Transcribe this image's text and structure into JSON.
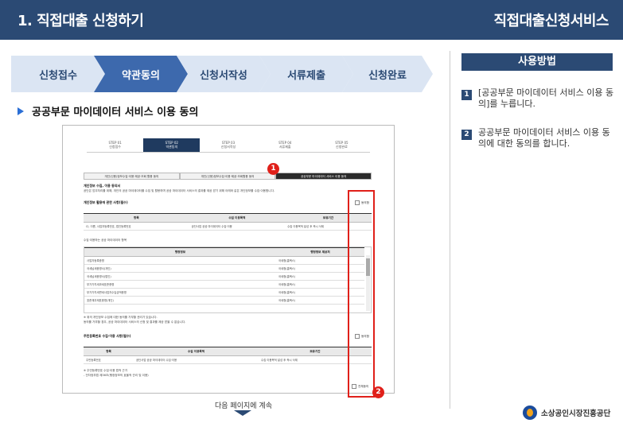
{
  "header": {
    "title": "1. 직접대출 신청하기",
    "service": "직접대출신청서비스"
  },
  "steps": [
    {
      "label": "신청접수",
      "active": false
    },
    {
      "label": "약관동의",
      "active": true
    },
    {
      "label": "신청서작성",
      "active": false
    },
    {
      "label": "서류제출",
      "active": false
    },
    {
      "label": "신청완료",
      "active": false
    }
  ],
  "section_title": "공공부문 마이데이터 서비스 이용 동의",
  "screenshot": {
    "mini_steps": [
      {
        "step": "STEP 01",
        "label": "신청접수"
      },
      {
        "step": "STEP 02",
        "label": "약관동의"
      },
      {
        "step": "STEP 03",
        "label": "신청서작성"
      },
      {
        "step": "STEP 04",
        "label": "서류제출"
      },
      {
        "step": "STEP 05",
        "label": "신청완료"
      }
    ],
    "tabs": [
      "개인(신용)정보수집·이용·제공·조회 활용 동의",
      "개인(신용)정보수집·이용·제공·조회활용 동의",
      "공공부문 마이데이터 서비스 이용 동의"
    ],
    "consent_title": "개인정보 수집, 이용 동의서",
    "consent_desc": "공단은 업무처리를 위해, 개인의 공공 마이데이터를 수집 및 활용하며 공공 마이데이터 서비스의 결과를 제공 받기 위해 아래와 같은 개인정보를 수집·이용합니다.",
    "section1": "개인정보 활용에 관한 사항(필수)",
    "agree_label": "동의함",
    "table_headers": [
      "항목",
      "수집 이용목적",
      "보유기간"
    ],
    "table_row": [
      "CI, 이름, 사업자등록번호, 법인등록번호",
      "공단사업 공공 마이데이터 수집·이용",
      "수집 이용목적 달성 후 즉시 삭제"
    ],
    "sub_title": "수집·이용하는 공공 마이데이터 항목",
    "list_headers": [
      "행정정보",
      "행정정보 제공처"
    ],
    "list_rows": [
      [
        "사업자등록증명",
        "국세청(홈택스)"
      ],
      [
        "국세납세증명서(개인)",
        "국세청(홈택스)"
      ],
      [
        "국세납세증명서(법인)",
        "국세청(홈택스)"
      ],
      [
        "부가가치세과세표준증명",
        "국세청(홈택스)"
      ],
      [
        "부가가치세면세사업자수입금액증명",
        "국세청(홈택스)"
      ],
      [
        "표준재무제표증명(개인)",
        "국세청(홈택스)"
      ]
    ],
    "notice1": "※ 위의 개인정보 수집에 대한 동의를 거부할 권리가 있습니다.",
    "notice2": "동의를 거부할 경우, 공공 마이데이터 서비스의 신청 및 결과를 제공 받을 수 없습니다.",
    "section2": "주민등록번호 수집·이용 사항(필수)",
    "table2_row": [
      "주민등록번호",
      "공단사업 공공 마이데이터 수집·이용",
      "수집 이용목적 달성 후 즉시 삭제"
    ],
    "law_note": "※ 주민등록번호 수집·이용 법적 근거",
    "law_note2": "- 전자정부법 제36조(행정정보의 효율적 관리 및 이용)",
    "agree_all": "전체동의"
  },
  "badges": [
    "1",
    "2"
  ],
  "next_page": "다음 페이지에 계속",
  "usage": {
    "title": "사용방법",
    "items": [
      {
        "num": "1",
        "text": "[공공부문 마이데이터 서비스 이용 동의]를 누릅니다."
      },
      {
        "num": "2",
        "text": "공공부문 마이데이터 서비스 이용 동의에 대한 동의를 합니다."
      }
    ]
  },
  "logo": {
    "name": "소상공인시장진흥공단"
  },
  "colors": {
    "navy": "#2b4a74",
    "step_fill": "#dbe5f3",
    "step_active": "#3d69ad",
    "red": "#e0201a"
  }
}
